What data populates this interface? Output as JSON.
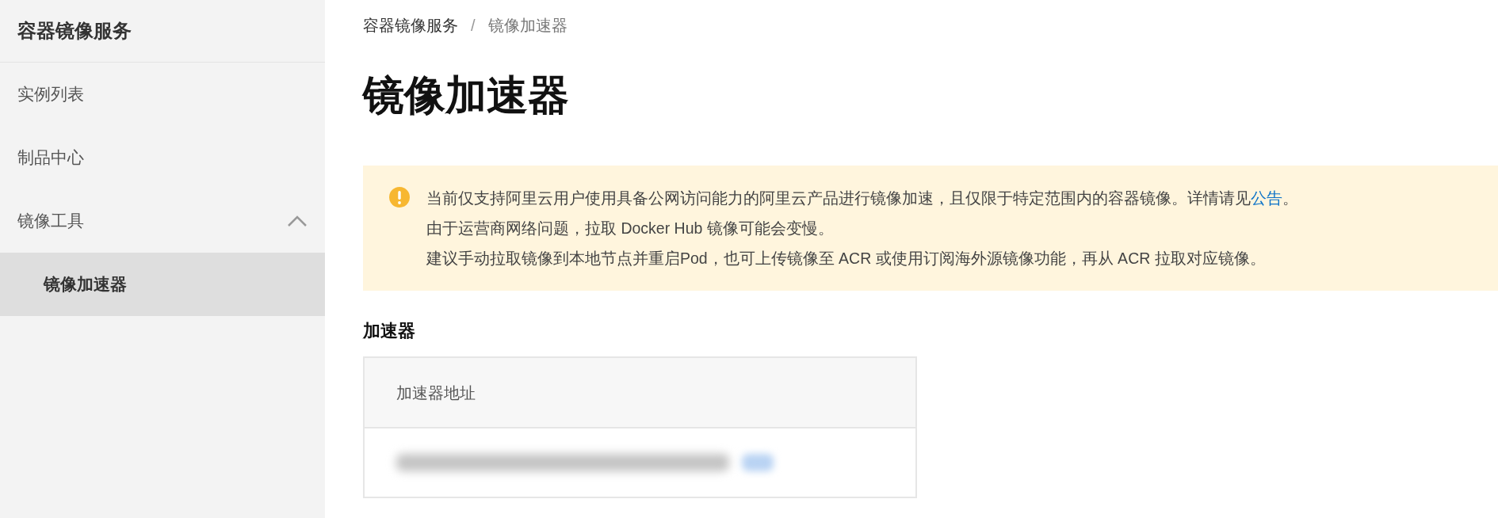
{
  "sidebar": {
    "title": "容器镜像服务",
    "items": [
      {
        "label": "实例列表",
        "selected": false
      },
      {
        "label": "制品中心",
        "selected": false
      },
      {
        "label": "镜像工具",
        "selected": false,
        "expanded": true,
        "children": [
          {
            "label": "镜像加速器",
            "selected": true
          }
        ]
      }
    ]
  },
  "breadcrumb": [
    "容器镜像服务",
    "镜像加速器"
  ],
  "breadcrumb_separator": "/",
  "page_title": "镜像加速器",
  "alert": {
    "lines": [
      "当前仅支持阿里云用户使用具备公网访问能力的阿里云产品进行镜像加速，且仅限于特定范围内的容器镜像。详情请见",
      "由于运营商网络问题，拉取 Docker Hub 镜像可能会变慢。",
      "建议手动拉取镜像到本地节点并重启Pod，也可上传镜像至 ACR 或使用订阅海外源镜像功能，再从 ACR 拉取对应镜像。"
    ],
    "link": "公告",
    "link_suffix": "。"
  },
  "section_title": "加速器",
  "table": {
    "columns": [
      "加速器地址"
    ]
  }
}
